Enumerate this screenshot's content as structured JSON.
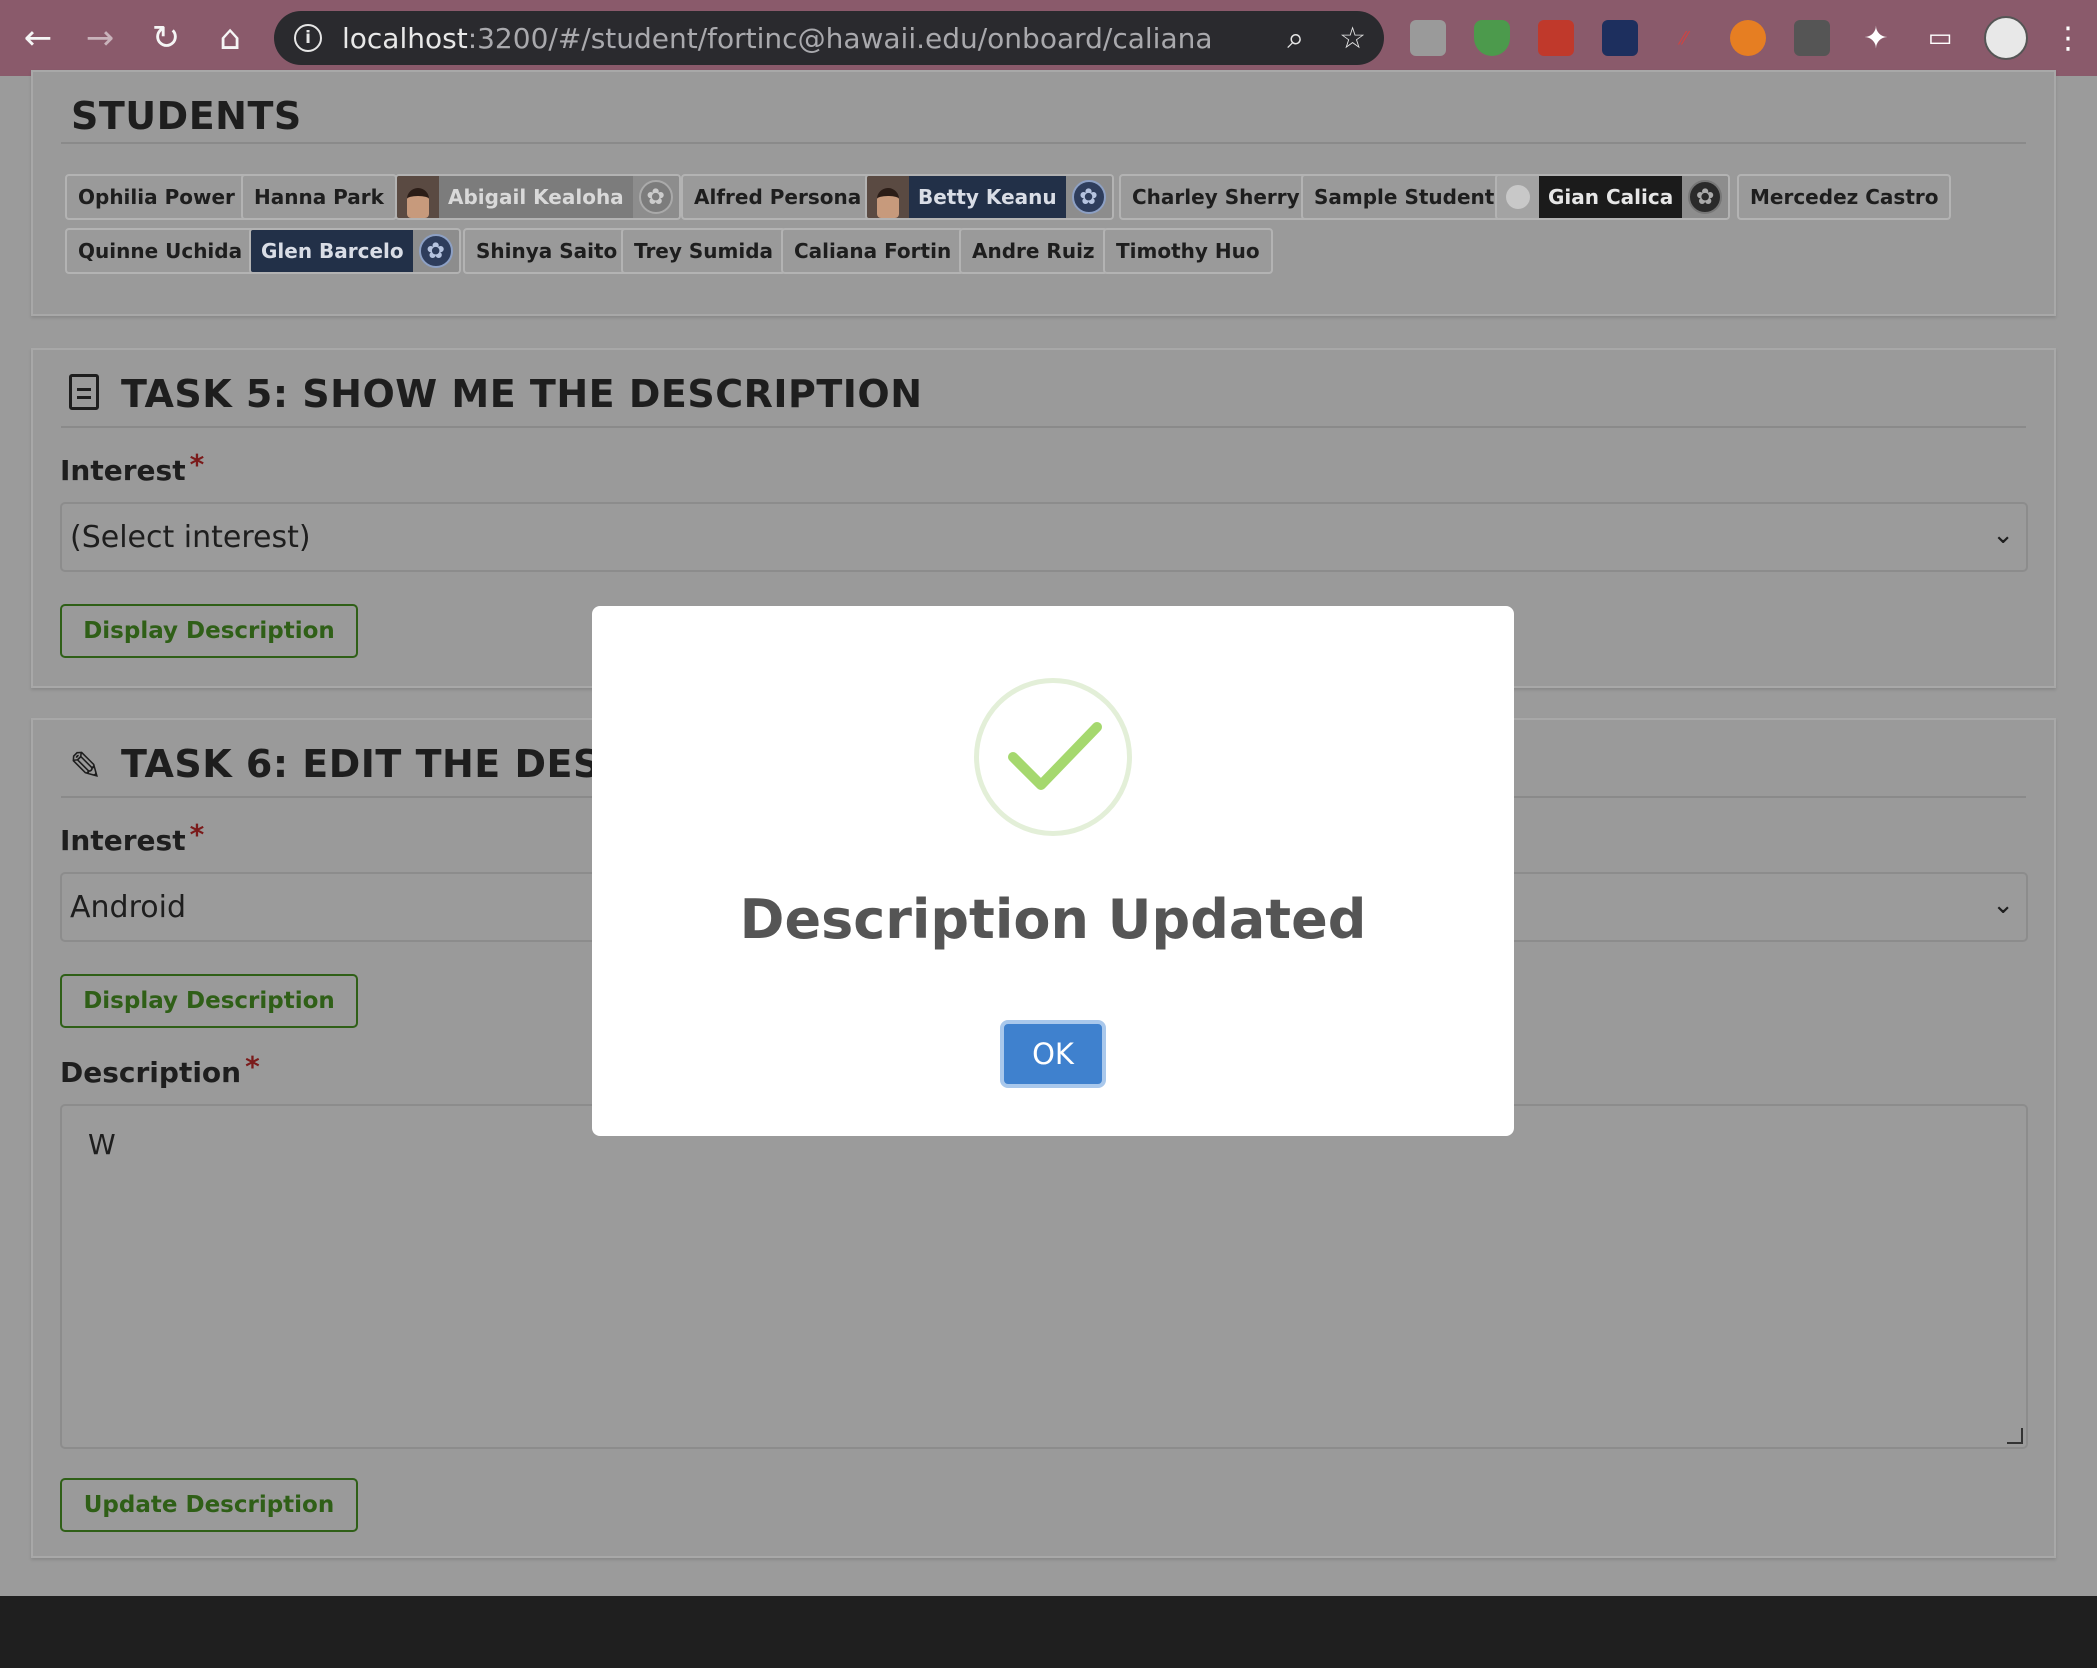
{
  "browser": {
    "url_host": "localhost",
    "url_rest": ":3200/#/student/fortinc@hawaii.edu/onboard/caliana",
    "info_icon": "i"
  },
  "students_card": {
    "title": "STUDENTS",
    "chips": [
      "Ophilia Power",
      "Hanna Park",
      "Abigail Kealoha",
      "Alfred Persona",
      "Betty Keanu",
      "Charley Sherry",
      "Sample Student",
      "Gian Calica",
      "Mercedez Castro",
      "Quinne Uchida",
      "Glen Barcelo",
      "Shinya Saito",
      "Trey Sumida",
      "Caliana Fortin",
      "Andre Ruiz",
      "Timothy Huo"
    ]
  },
  "task5": {
    "title": "TASK 5: SHOW ME THE DESCRIPTION",
    "interest_label": "Interest",
    "required_mark": "*",
    "interest_value": "(Select interest)",
    "display_button": "Display Description"
  },
  "task6": {
    "title": "TASK 6: EDIT THE DESCRIP",
    "interest_label": "Interest",
    "required_mark": "*",
    "interest_value": "Android",
    "display_button": "Display Description",
    "description_label": "Description",
    "description_value": "W",
    "update_button": "Update Description"
  },
  "modal": {
    "title": "Description Updated",
    "ok_label": "OK"
  },
  "colors": {
    "chrome": "#8a5a6b",
    "success_green": "#a5d86e",
    "ok_blue": "#3f81ce",
    "outline_green": "#2f5f17"
  }
}
